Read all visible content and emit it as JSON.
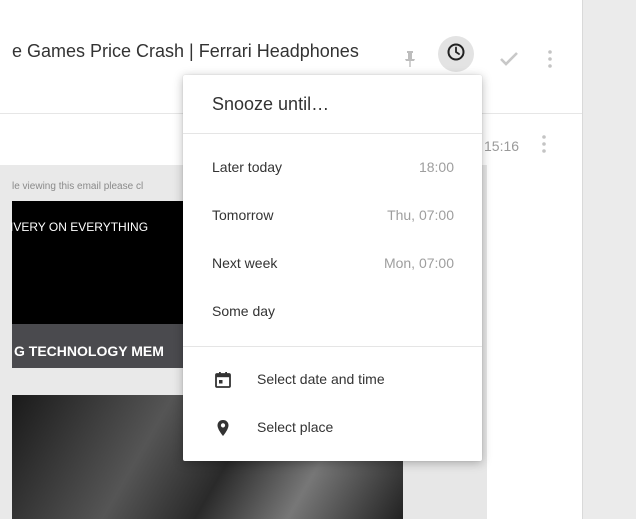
{
  "subject": "e Games Price Crash | Ferrari Headphones",
  "toolbar": {
    "pin_icon": "pin-icon",
    "snooze_icon": "clock-icon",
    "done_icon": "check-icon",
    "more_icon": "more-vert-icon"
  },
  "message": {
    "time": "15:16",
    "email_note": "le viewing this email please cl",
    "email_banner": "IVERY ON EVERYTHING",
    "email_nav": "G  TECHNOLOGY  MEM"
  },
  "snooze_menu": {
    "title": "Snooze until…",
    "options": [
      {
        "label": "Later today",
        "time": "18:00"
      },
      {
        "label": "Tomorrow",
        "time": "Thu, 07:00"
      },
      {
        "label": "Next week",
        "time": "Mon, 07:00"
      },
      {
        "label": "Some day",
        "time": ""
      }
    ],
    "extra": [
      {
        "label": "Select date and time",
        "icon": "calendar-icon"
      },
      {
        "label": "Select place",
        "icon": "location-pin-icon"
      }
    ]
  },
  "colors": {
    "background": "#ebebeb",
    "snooze_active_bg": "#e3e3e3",
    "text": "#333333",
    "muted": "#9e9e9e"
  }
}
